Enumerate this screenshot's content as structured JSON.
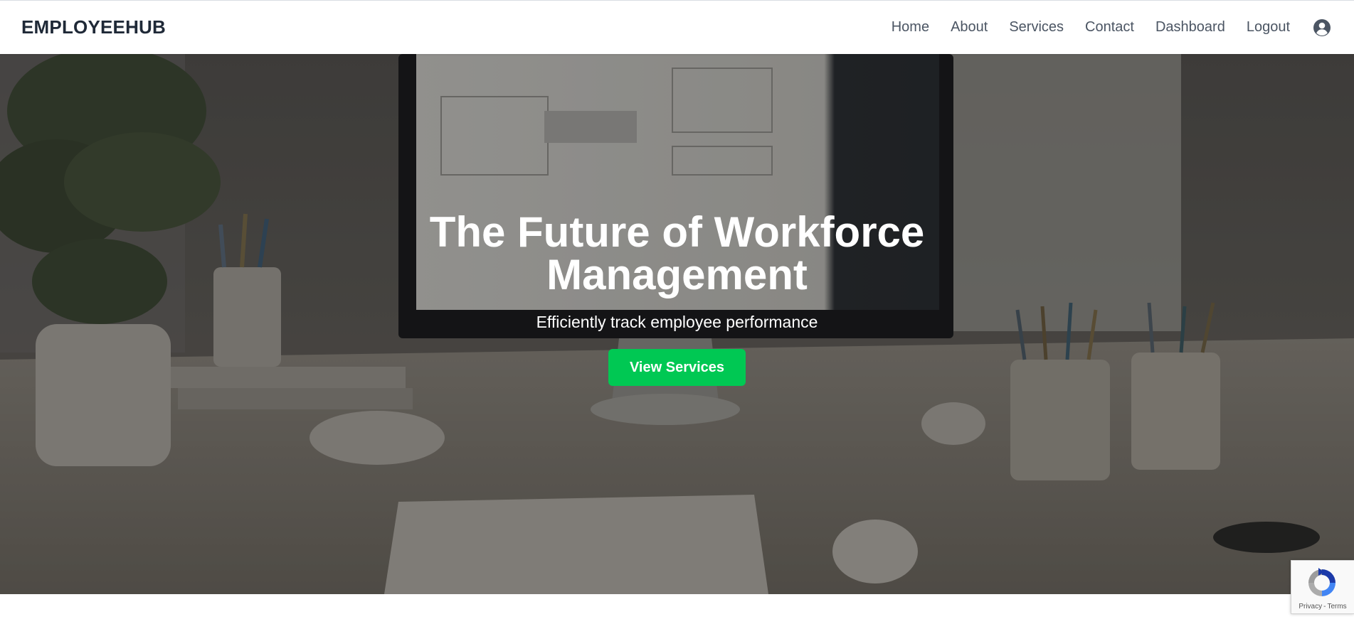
{
  "brand": {
    "name": "EMPLOYEEHUB"
  },
  "nav": {
    "links": [
      "Home",
      "About",
      "Services",
      "Contact",
      "Dashboard",
      "Logout"
    ],
    "user_icon": "user-circle-icon"
  },
  "hero": {
    "title": "The Future of Workforce Management",
    "subtitle": "Efficiently track employee performance",
    "cta_label": "View Services",
    "background_image": "office desk with monitor, plants, pencil cups, keyboard and mouse",
    "cta_color": "#00c853"
  },
  "recaptcha": {
    "privacy": "Privacy",
    "separator": "-",
    "terms": "Terms"
  }
}
